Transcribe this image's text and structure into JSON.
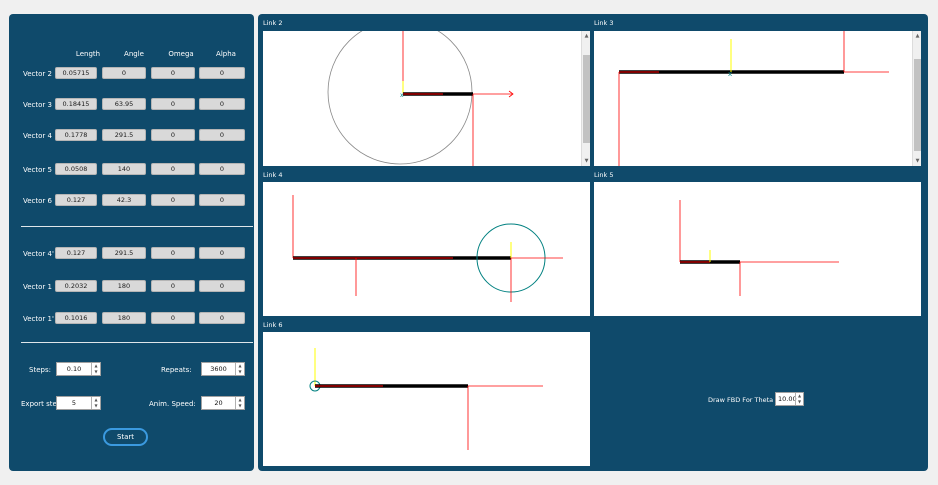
{
  "table": {
    "headers": [
      "Length",
      "Angle",
      "Omega",
      "Alpha"
    ],
    "rows": [
      {
        "label": "Vector 2",
        "length": "0.05715",
        "angle": "0",
        "omega": "0",
        "alpha": "0"
      },
      {
        "label": "Vector 3",
        "length": "0.18415",
        "angle": "63.95",
        "omega": "0",
        "alpha": "0"
      },
      {
        "label": "Vector 4",
        "length": "0.1778",
        "angle": "291.5",
        "omega": "0",
        "alpha": "0"
      },
      {
        "label": "Vector 5",
        "length": "0.0508",
        "angle": "140",
        "omega": "0",
        "alpha": "0"
      },
      {
        "label": "Vector 6",
        "length": "0.127",
        "angle": "42.3",
        "omega": "0",
        "alpha": "0"
      },
      {
        "label": "Vector 4'",
        "length": "0.127",
        "angle": "291.5",
        "omega": "0",
        "alpha": "0"
      },
      {
        "label": "Vector 1",
        "length": "0.2032",
        "angle": "180",
        "omega": "0",
        "alpha": "0"
      },
      {
        "label": "Vector 1'",
        "length": "0.1016",
        "angle": "180",
        "omega": "0",
        "alpha": "0"
      }
    ]
  },
  "controls": {
    "steps_label": "Steps:",
    "steps_value": "0.10",
    "repeats_label": "Repeats:",
    "repeats_value": "3600",
    "export_label": "Export step",
    "export_value": "5",
    "anim_label": "Anim. Speed:",
    "anim_value": "20",
    "start_label": "Start"
  },
  "plots": {
    "link2": "Link 2",
    "link3": "Link 3",
    "link4": "Link 4",
    "link5": "Link 5",
    "link6": "Link 6"
  },
  "fbd": {
    "label": "Draw FBD For Theta =",
    "value": "10.00"
  },
  "colors": {
    "panel": "#0f4a6b",
    "force": "#ff0000",
    "gravity": "#ffff00",
    "link": "#000000",
    "circle": "#008080"
  }
}
